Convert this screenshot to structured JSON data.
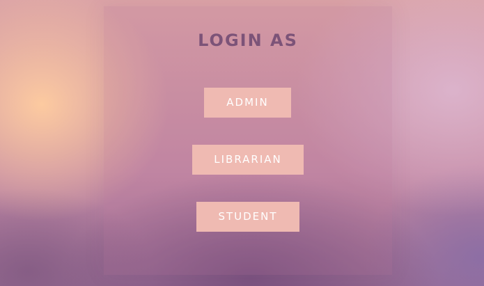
{
  "login": {
    "title": "LOGIN AS",
    "buttons": {
      "admin": "ADMIN",
      "librarian": "LIBRARIAN",
      "student": "STUDENT"
    }
  },
  "colors": {
    "title": "#7c5378",
    "button_bg": "#efbab2",
    "button_text": "#ffffff"
  }
}
